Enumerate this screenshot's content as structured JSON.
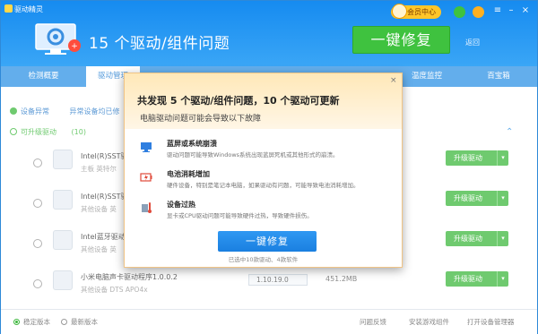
{
  "app": {
    "name": "驱动精灵"
  },
  "header": {
    "title": "15 个驱动/组件问题",
    "fix_button": "一键修复",
    "back": "返回",
    "vip": "会员中心"
  },
  "tabs": [
    "检测概要",
    "驱动管理",
    "",
    "",
    "温度监控",
    "百宝箱"
  ],
  "status": {
    "abnormal_label": "设备异常",
    "abnormal_desc": "异常设备均已修",
    "upgradable_label": "可升级驱动",
    "upgradable_count": "(10)"
  },
  "rows": [
    {
      "name": "Intel(R)SST驱动",
      "sub": "主板    英特尔",
      "action": "升级驱动"
    },
    {
      "name": "Intel(R)SST驱动",
      "sub": "其他设备    英",
      "action": "升级驱动"
    },
    {
      "name": "Intel蓝牙驱动",
      "sub": "其他设备    英",
      "action": "升级驱动"
    },
    {
      "name": "小米电脑声卡驱动程序1.0.0.2",
      "sub": "其他设备    DTS APO4x",
      "action": "升级驱动",
      "version": "1.10.19.0",
      "size": "451.2MB"
    }
  ],
  "footer": {
    "stable": "稳定版本",
    "latest": "最新版本",
    "feedback": "问题反馈",
    "game": "安装游戏组件",
    "device_manager": "打开设备管理器"
  },
  "popup": {
    "title": "共发现 5 个驱动/组件问题，10 个驱动可更新",
    "subtitle": "电脑驱动问题可能会导致以下故障",
    "close": "×",
    "issues": [
      {
        "title": "蓝屏或系统崩溃",
        "desc": "驱动问题可能导致Windows系统出现蓝屏死机或其他形式的崩溃。",
        "icon": "blue-screen-icon"
      },
      {
        "title": "电池消耗增加",
        "desc": "硬件设备，特别是笔记本电脑，如果驱动有问题，可能导致电池消耗增加。",
        "icon": "battery-icon"
      },
      {
        "title": "设备过热",
        "desc": "显卡或CPU驱动问题可能导致硬件过热，导致硬件损伤。",
        "icon": "thermometer-icon"
      }
    ],
    "button": "一键修复",
    "note": "已选中10款驱动、4款软件"
  },
  "colors": {
    "primary": "#1a7fe0",
    "green": "#3fb83f"
  }
}
